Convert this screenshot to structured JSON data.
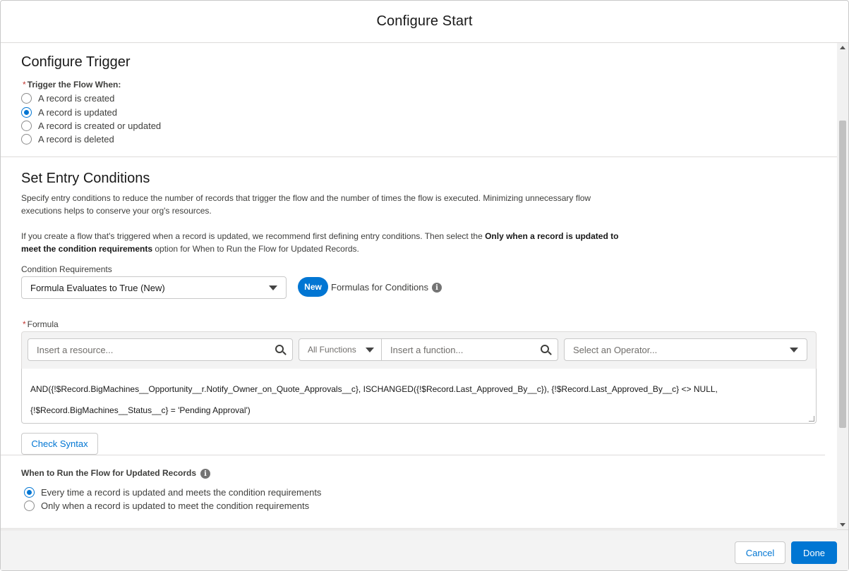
{
  "modal": {
    "title": "Configure Start"
  },
  "trigger": {
    "heading": "Configure Trigger",
    "field_label": "Trigger the Flow When:",
    "required_marker": "*",
    "options": [
      {
        "label": "A record is created",
        "checked": false
      },
      {
        "label": "A record is updated",
        "checked": true
      },
      {
        "label": "A record is created or updated",
        "checked": false
      },
      {
        "label": "A record is deleted",
        "checked": false
      }
    ]
  },
  "entry": {
    "heading": "Set Entry Conditions",
    "description_1": "Specify entry conditions to reduce the number of records that trigger the flow and the number of times the flow is executed. Minimizing unnecessary flow executions helps to conserve your org's resources.",
    "description_2_start": "If you create a flow that's triggered when a record is updated, we recommend first defining entry conditions. Then select the ",
    "description_2_bold": "Only when a record is updated to meet the condition requirements",
    "description_2_end": " option for When to Run the Flow for Updated Records.",
    "condition_label": "Condition Requirements",
    "condition_value": "Formula Evaluates to True (New)",
    "new_badge": "New",
    "formulas_link": "Formulas for Conditions",
    "info_glyph": "i"
  },
  "formula": {
    "label": "Formula",
    "required_marker": "*",
    "resource_placeholder": "Insert a resource...",
    "functions_filter": "All Functions",
    "function_placeholder": "Insert a function...",
    "operator_placeholder": "Select an Operator...",
    "line_1": "AND({!$Record.BigMachines__Opportunity__r.Notify_Owner_on_Quote_Approvals__c}, ISCHANGED({!$Record.Last_Approved_By__c}), {!$Record.Last_Approved_By__c} <> NULL,",
    "line_2": "{!$Record.BigMachines__Status__c} = 'Pending Approval')",
    "check_syntax": "Check Syntax"
  },
  "when_to_run": {
    "label": "When to Run the Flow for Updated Records",
    "options": [
      {
        "label": "Every time a record is updated and meets the condition requirements",
        "checked": true
      },
      {
        "label": "Only when a record is updated to meet the condition requirements",
        "checked": false
      }
    ]
  },
  "footer": {
    "cancel": "Cancel",
    "done": "Done"
  },
  "colors": {
    "brand": "#0176d3",
    "required": "#c23934",
    "footer_bg": "#f3f3f3"
  }
}
